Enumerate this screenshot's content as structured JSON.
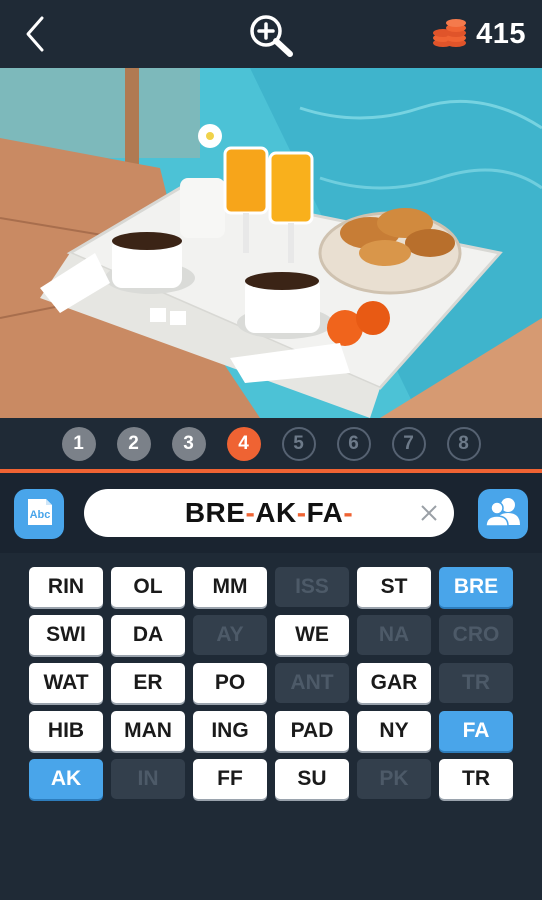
{
  "header": {
    "back_icon": "chevron-left-icon",
    "zoom_icon": "zoom-in-icon",
    "coin_icon": "coin-stack-icon",
    "coins": "415"
  },
  "photo": {
    "subject_icon": "breakfast-tray-photo"
  },
  "levels": [
    {
      "label": "1",
      "state": "done"
    },
    {
      "label": "2",
      "state": "done"
    },
    {
      "label": "3",
      "state": "done"
    },
    {
      "label": "4",
      "state": "current"
    },
    {
      "label": "5",
      "state": "todo"
    },
    {
      "label": "6",
      "state": "todo"
    },
    {
      "label": "7",
      "state": "todo"
    },
    {
      "label": "8",
      "state": "todo"
    }
  ],
  "answer": {
    "parts": [
      "BRE",
      "-",
      "AK",
      "-",
      "FA",
      "-"
    ],
    "clear_icon": "close-icon",
    "hint_icon": "abc-icon",
    "friends_icon": "friends-icon"
  },
  "tiles": [
    {
      "label": "RIN",
      "state": "avail"
    },
    {
      "label": "OL",
      "state": "avail"
    },
    {
      "label": "MM",
      "state": "avail"
    },
    {
      "label": "ISS",
      "state": "used"
    },
    {
      "label": "ST",
      "state": "avail"
    },
    {
      "label": "BRE",
      "state": "placed"
    },
    {
      "label": "SWI",
      "state": "avail"
    },
    {
      "label": "DA",
      "state": "avail"
    },
    {
      "label": "AY",
      "state": "used"
    },
    {
      "label": "WE",
      "state": "avail"
    },
    {
      "label": "NA",
      "state": "used"
    },
    {
      "label": "CRO",
      "state": "used"
    },
    {
      "label": "WAT",
      "state": "avail"
    },
    {
      "label": "ER",
      "state": "avail"
    },
    {
      "label": "PO",
      "state": "avail"
    },
    {
      "label": "ANT",
      "state": "used"
    },
    {
      "label": "GAR",
      "state": "avail"
    },
    {
      "label": "TR",
      "state": "used"
    },
    {
      "label": "HIB",
      "state": "avail"
    },
    {
      "label": "MAN",
      "state": "avail"
    },
    {
      "label": "ING",
      "state": "avail"
    },
    {
      "label": "PAD",
      "state": "avail"
    },
    {
      "label": "NY",
      "state": "avail"
    },
    {
      "label": "FA",
      "state": "placed"
    },
    {
      "label": "AK",
      "state": "placed"
    },
    {
      "label": "IN",
      "state": "used"
    },
    {
      "label": "FF",
      "state": "avail"
    },
    {
      "label": "SU",
      "state": "avail"
    },
    {
      "label": "PK",
      "state": "used"
    },
    {
      "label": "TR",
      "state": "avail"
    }
  ],
  "colors": {
    "background": "#1f2a36",
    "accent": "#ef6333",
    "blue": "#49a5ea"
  }
}
